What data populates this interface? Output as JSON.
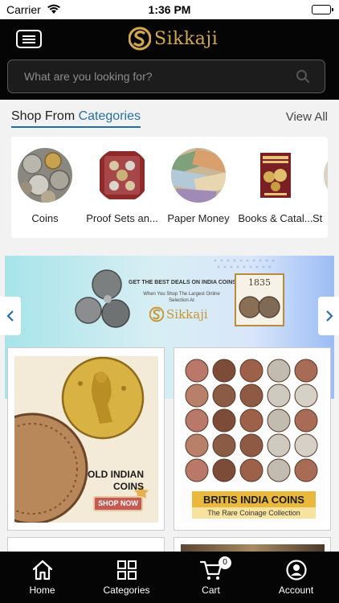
{
  "status_bar": {
    "carrier": "Carrier",
    "time": "1:36 PM"
  },
  "header": {
    "brand": "Sikkaji",
    "search_placeholder": "What are you looking for?"
  },
  "categories_section": {
    "title_prefix": "Shop From",
    "title_accent": "Categories",
    "view_all": "View All",
    "items": [
      {
        "label": "Coins"
      },
      {
        "label": "Proof Sets an..."
      },
      {
        "label": "Paper Money"
      },
      {
        "label": "Books & Catal..."
      },
      {
        "label": "St"
      }
    ]
  },
  "banner": {
    "headline": "GET THE BEST DEALS ON INDIA COINS",
    "subtext": "When You Shop The Largest Online Selection At",
    "brand": "Sikkaji",
    "year": "1835"
  },
  "promos": {
    "left": {
      "title_line1": "OLD INDIAN",
      "title_line2": "COINS",
      "cta": "SHOP NOW"
    },
    "right": {
      "title": "BRITIS INDIA COINS",
      "subtitle": "The Rare Coinage Collection"
    }
  },
  "tabbar": {
    "items": [
      {
        "label": "Home",
        "icon": "home-icon"
      },
      {
        "label": "Categories",
        "icon": "grid-icon"
      },
      {
        "label": "Cart",
        "icon": "cart-icon",
        "badge": "0"
      },
      {
        "label": "Account",
        "icon": "account-icon"
      }
    ]
  },
  "colors": {
    "header_bg": "#050505",
    "brand_gold": "#d4a84c",
    "accent_blue": "#2371a8"
  }
}
